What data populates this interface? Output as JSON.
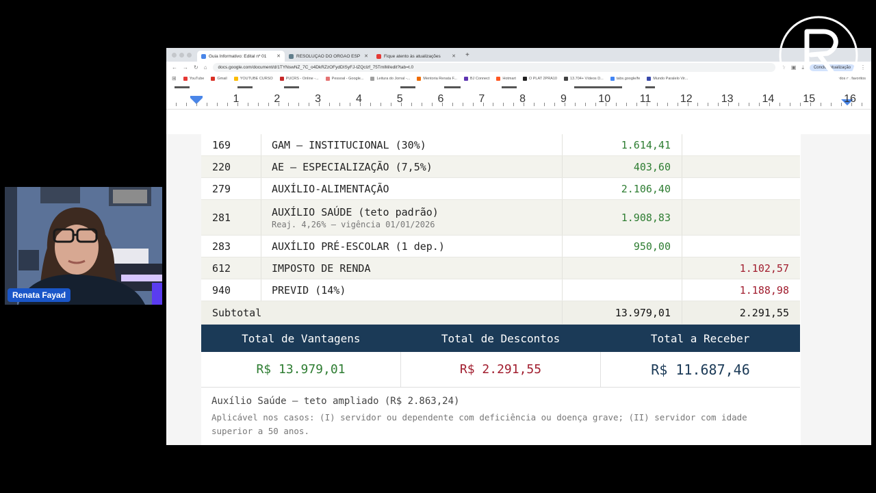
{
  "browser": {
    "tabs": [
      {
        "label": "Guia Informativo: Edital nº 01",
        "active": true,
        "color": "#4a86e8"
      },
      {
        "label": "RESOLUÇÃO DO ÓRGÃO ESP",
        "active": false,
        "color": "#607d8b"
      },
      {
        "label": "Fique atento às atualizações",
        "active": false,
        "color": "#e53935"
      }
    ],
    "new_tab": "+",
    "url": "docs.google.com/document/d/1TYNswNZ_7C_o4DkRZzOFydDISyFJ-tZQclzf_75TmlM/edit?tab=t.0",
    "update_label": "Concluir atualização",
    "bookmarks": [
      {
        "label": "YouTube",
        "color": "#e53935"
      },
      {
        "label": "Gmail",
        "color": "#d93025"
      },
      {
        "label": "YOUTUBE CURSO",
        "color": "#fbbc04"
      },
      {
        "label": "PUCRS - Online -...",
        "color": "#c62828"
      },
      {
        "label": "Pessoal - Google...",
        "color": "#e57373"
      },
      {
        "label": "Leitura do Jornal -...",
        "color": "#9e9e9e"
      },
      {
        "label": "Mentoria Renata F...",
        "color": "#ef6c00"
      },
      {
        "label": "BJ Connect",
        "color": "#5e35b1"
      },
      {
        "label": "Hotmart",
        "color": "#ff5722"
      },
      {
        "label": "O PLAT 2PRA10",
        "color": "#212121"
      },
      {
        "label": "13.704+ Vídeos D...",
        "color": "#424242"
      },
      {
        "label": "tabs.google/fe",
        "color": "#4285f4"
      },
      {
        "label": "Mundo Paralelo Vir...",
        "color": "#3949ab"
      }
    ],
    "bookmarks_end": "Todos os favoritos"
  },
  "ruler": {
    "numbers": [
      "1",
      "2",
      "3",
      "4",
      "5",
      "6",
      "7",
      "8",
      "9",
      "10",
      "11",
      "12",
      "13",
      "14",
      "15",
      "16"
    ]
  },
  "table": {
    "rows": [
      {
        "code": "169",
        "desc": "GAM — INSTITUCIONAL (30%)",
        "sub": "",
        "vant": "1.614,41",
        "desc_val": ""
      },
      {
        "code": "220",
        "desc": "AE — ESPECIALIZAÇÃO (7,5%)",
        "sub": "",
        "vant": "403,60",
        "desc_val": ""
      },
      {
        "code": "279",
        "desc": "AUXÍLIO-ALIMENTAÇÃO",
        "sub": "",
        "vant": "2.106,40",
        "desc_val": ""
      },
      {
        "code": "281",
        "desc": "AUXÍLIO SAÚDE (teto padrão)",
        "sub": "Reaj. 4,26% — vigência 01/01/2026",
        "vant": "1.908,83",
        "desc_val": ""
      },
      {
        "code": "283",
        "desc": "AUXÍLIO PRÉ-ESCOLAR (1 dep.)",
        "sub": "",
        "vant": "950,00",
        "desc_val": ""
      },
      {
        "code": "612",
        "desc": "IMPOSTO DE RENDA",
        "sub": "",
        "vant": "",
        "desc_val": "1.102,57"
      },
      {
        "code": "940",
        "desc": "PREVID (14%)",
        "sub": "",
        "vant": "",
        "desc_val": "1.188,98"
      }
    ],
    "subtotal_label": "Subtotal",
    "subtotal_vant": "13.979,01",
    "subtotal_desc": "2.291,55"
  },
  "totals": {
    "head_vant": "Total de Vantagens",
    "head_desc": "Total de Descontos",
    "head_receber": "Total a Receber",
    "val_vant": "R$ 13.979,01",
    "val_desc": "R$ 2.291,55",
    "val_receber": "R$ 11.687,46"
  },
  "note": {
    "title": "Auxílio Saúde — teto ampliado (R$ 2.863,24)",
    "body": "Aplicável nos casos: (I) servidor ou dependente com deficiência ou doença grave; (II) servidor com idade superior a 50 anos."
  },
  "webcam": {
    "name": "Renata Fayad"
  },
  "colors": {
    "header_navy": "#1b3a57",
    "positive_green": "#2e7d32",
    "negative_red": "#a11d2e",
    "ruler_marker": "#4a86e8"
  }
}
